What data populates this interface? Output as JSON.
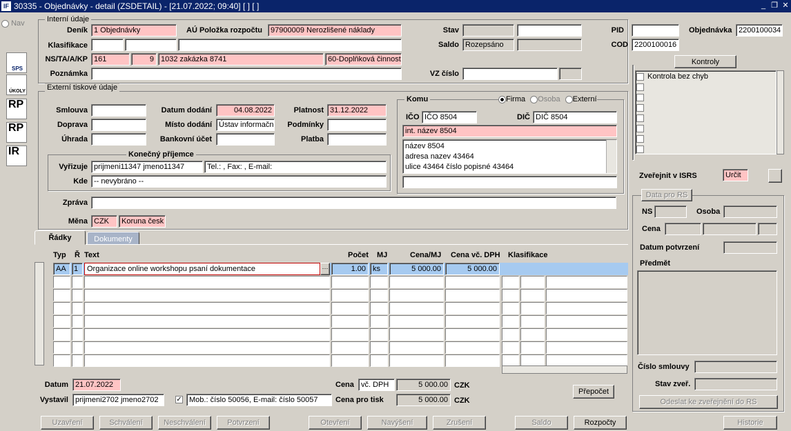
{
  "window": {
    "title": "30335 - Objednávky - detail (ZSDETAIL) - [21.07.2022; 09:40]  [ ]  [ ]",
    "logo": "IF",
    "min": "_",
    "restore": "❐",
    "close": "✕"
  },
  "nav": {
    "label": "Nav",
    "sps": "SPS",
    "ukoly": "ÚKOLY",
    "rp1": "RP",
    "rp2": "RP",
    "ir": "IR"
  },
  "interni": {
    "title": "Interní údaje",
    "denik_label": "Deník",
    "denik": "1 Objednávky",
    "au_label": "AÚ Položka rozpočtu",
    "au": "97900009 Nerozlišené náklady",
    "klas_label": "Klasifikace",
    "ns_label": "NS/TA/A/KP",
    "ns1": "161",
    "ns2": "9",
    "ns3": "1032 zakázka 8741",
    "ns4": "60-Doplňková činnost",
    "pozn_label": "Poznámka",
    "stav_label": "Stav",
    "saldo_label": "Saldo",
    "saldo": "Rozepsáno",
    "vz_label": "VZ číslo",
    "pid_label": "PID",
    "cod_label": "COD",
    "cod": "2200100016",
    "obj_label": "Objednávka",
    "obj": "2200100034"
  },
  "externi": {
    "title": "Externí tiskové údaje",
    "smlouva_label": "Smlouva",
    "doprava_label": "Doprava",
    "uhrada_label": "Úhrada",
    "datum_dodani_label": "Datum dodání",
    "datum_dodani": "04.08.2022",
    "misto_label": "Místo dodání",
    "misto": "Ústav informační",
    "bank_label": "Bankovní účet",
    "platnost_label": "Platnost",
    "platnost": "31.12.2022",
    "podminky_label": "Podmínky",
    "platba_label": "Platba"
  },
  "prijemce": {
    "title": "Konečný příjemce",
    "vyrizuje_label": "Vyřizuje",
    "vyrizuje": "prijmeni11347 jmeno11347",
    "kontakt": "Tel.: , Fax: , E-mail:",
    "kde_label": "Kde",
    "kde": "-- nevybráno --"
  },
  "komu": {
    "title": "Komu",
    "firma": "Firma",
    "osoba": "Osoba",
    "externi": "Externí",
    "ico_label": "IČO",
    "ico": "IČO 8504",
    "dic_label": "DIČ",
    "dic": "DIČ 8504",
    "nazev": "int. název 8504",
    "addr1": "název 8504",
    "addr2": "adresa nazev 43464",
    "addr3": "ulice 43464 číslo popisné 43464"
  },
  "zprava_label": "Zpráva",
  "mena": {
    "label": "Měna",
    "kod": "CZK",
    "nazev": "Koruna česk"
  },
  "tabs": {
    "radky": "Řádky",
    "dokumenty": "Dokumenty"
  },
  "grid": {
    "headers": {
      "typ": "Typ",
      "r": "Ř",
      "text": "Text",
      "pocet": "Počet",
      "mj": "MJ",
      "cena": "Cena/MJ",
      "cenadph": "Cena vč. DPH",
      "klas": "Klasifikace"
    },
    "row": {
      "typ": "AA",
      "r": "1",
      "text": "Organizace online workshopu psaní dokumentace",
      "more": "···",
      "pocet": "1.00",
      "mj": "ks",
      "cena": "5 000.00",
      "cenadph": "5 000.00"
    }
  },
  "footer": {
    "datum_label": "Datum",
    "datum": "21.07.2022",
    "vystavil_label": "Vystavil",
    "vystavil": "prijmeni2702 jmeno2702",
    "kontakt": "Mob.: číslo 50056, E-mail: číslo 50057",
    "cena_label": "Cena",
    "cena_typ": "vč. DPH",
    "cena": "5 000.00",
    "czk1": "CZK",
    "cenatisk_label": "Cena pro tisk",
    "cenatisk": "5 000.00",
    "czk2": "CZK",
    "prepocet": "Přepočet"
  },
  "buttons": {
    "uzavreni": "Uzavření",
    "schvaleni": "Schválení",
    "neschvaleni": "Neschválení",
    "potvrzeni": "Potvrzení",
    "otevreni": "Otevření",
    "navyseni": "Navýšení",
    "zruseni": "Zrušení",
    "saldo": "Saldo",
    "rozpocty": "Rozpočty",
    "historie": "Historie"
  },
  "kontroly": {
    "button": "Kontroly",
    "item1": "Kontrola bez chyb"
  },
  "isrs": {
    "label": "Zveřejnit v ISRS",
    "value": "Určit"
  },
  "rs": {
    "title": "Data pro RS",
    "ns_label": "NS",
    "osoba_label": "Osoba",
    "cena_label": "Cena",
    "datum_label": "Datum potvrzení",
    "predmet_label": "Předmět",
    "smlouva_label": "Číslo smlouvy",
    "stav_label": "Stav zveř.",
    "odeslat": "Odeslat ke zveřejnění do RS"
  }
}
